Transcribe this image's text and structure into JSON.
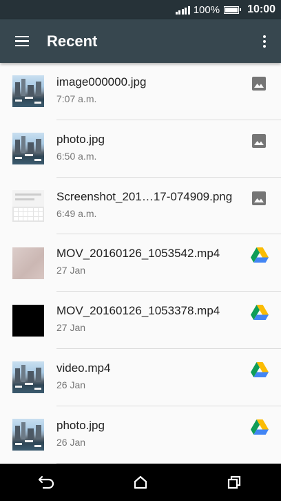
{
  "status_bar": {
    "battery_percent": "100%",
    "battery_level": 1.0,
    "clock": "10:00",
    "signal_icon": "signal-bars-icon",
    "battery_icon": "battery-icon"
  },
  "app_bar": {
    "title": "Recent",
    "menu_icon": "hamburger-menu-icon",
    "more_icon": "overflow-menu-icon",
    "background": "#37474f"
  },
  "files": [
    {
      "name": "image000000.jpg",
      "date": "7:07 a.m.",
      "thumbnail": "city-harbor",
      "source_icon": "image-icon"
    },
    {
      "name": "photo.jpg",
      "date": "6:50 a.m.",
      "thumbnail": "city-harbor",
      "source_icon": "image-icon"
    },
    {
      "name": "Screenshot_201…17-074909.png",
      "date": "6:49 a.m.",
      "thumbnail": "screenshot-keyboard",
      "source_icon": "image-icon"
    },
    {
      "name": "MOV_20160126_1053542.mp4",
      "date": "27 Jan",
      "thumbnail": "pinkish-blur",
      "source_icon": "google-drive-icon"
    },
    {
      "name": "MOV_20160126_1053378.mp4",
      "date": "27 Jan",
      "thumbnail": "black",
      "source_icon": "google-drive-icon"
    },
    {
      "name": "video.mp4",
      "date": "26 Jan",
      "thumbnail": "city-harbor",
      "source_icon": "google-drive-icon"
    },
    {
      "name": "photo.jpg",
      "date": "26 Jan",
      "thumbnail": "city-harbor",
      "source_icon": "google-drive-icon"
    }
  ],
  "nav_bar": {
    "back_icon": "back-icon",
    "home_icon": "home-icon",
    "recents_icon": "recent-apps-icon"
  }
}
